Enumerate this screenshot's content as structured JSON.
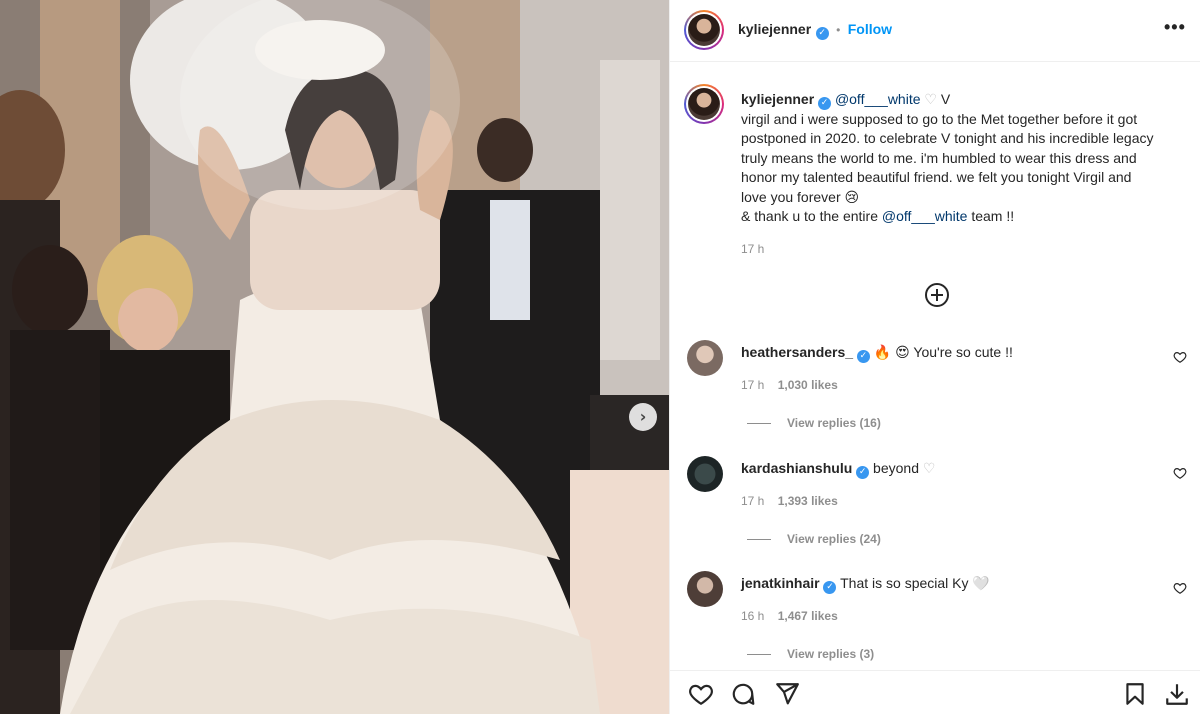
{
  "header": {
    "username": "kyliejenner",
    "verified_icon": "verified-badge-icon",
    "separator": "•",
    "follow_label": "Follow",
    "more_icon": "more-options-icon",
    "more_label": "•••"
  },
  "post": {
    "next_icon": "chevron-right-icon",
    "next_label": "›"
  },
  "caption": {
    "username": "kyliejenner",
    "mention": "@off___white",
    "after_mention": " V",
    "lines": [
      "virgil and i were supposed to go to the Met together before it got",
      "postponed in 2020. to celebrate V tonight and his incredible legacy",
      "truly means the world to me. i'm humbled to wear this dress and",
      "honor my talented beautiful friend. we felt you tonight Virgil and",
      "love you forever 😢"
    ],
    "thanks_prefix": "& thank u to the entire ",
    "thanks_mention": "@off___white",
    "thanks_suffix": " team !!",
    "time": "17 h"
  },
  "load_more_icon": "add-circle-icon",
  "comments": [
    {
      "username": "heathersanders_",
      "emoji": "🔥 😍",
      "text": "You're so cute !!",
      "time": "17 h",
      "likes": "1,030 likes",
      "replies": "View replies (16)"
    },
    {
      "username": "kardashianshulu",
      "emoji": "",
      "text": "beyond",
      "time": "17 h",
      "likes": "1,393 likes",
      "replies": "View replies (24)"
    },
    {
      "username": "jenatkinhair",
      "emoji": "",
      "text": "That is so special Ky 🤍",
      "time": "16 h",
      "likes": "1,467 likes",
      "replies": "View replies (3)"
    }
  ],
  "action_icons": [
    "heart-icon",
    "comment-icon",
    "share-icon",
    "bookmark-icon",
    "download-icon"
  ],
  "colors": {
    "accent": "#0095f6",
    "verified": "#3897f0",
    "text": "#262626",
    "muted": "#8e8e8e"
  }
}
